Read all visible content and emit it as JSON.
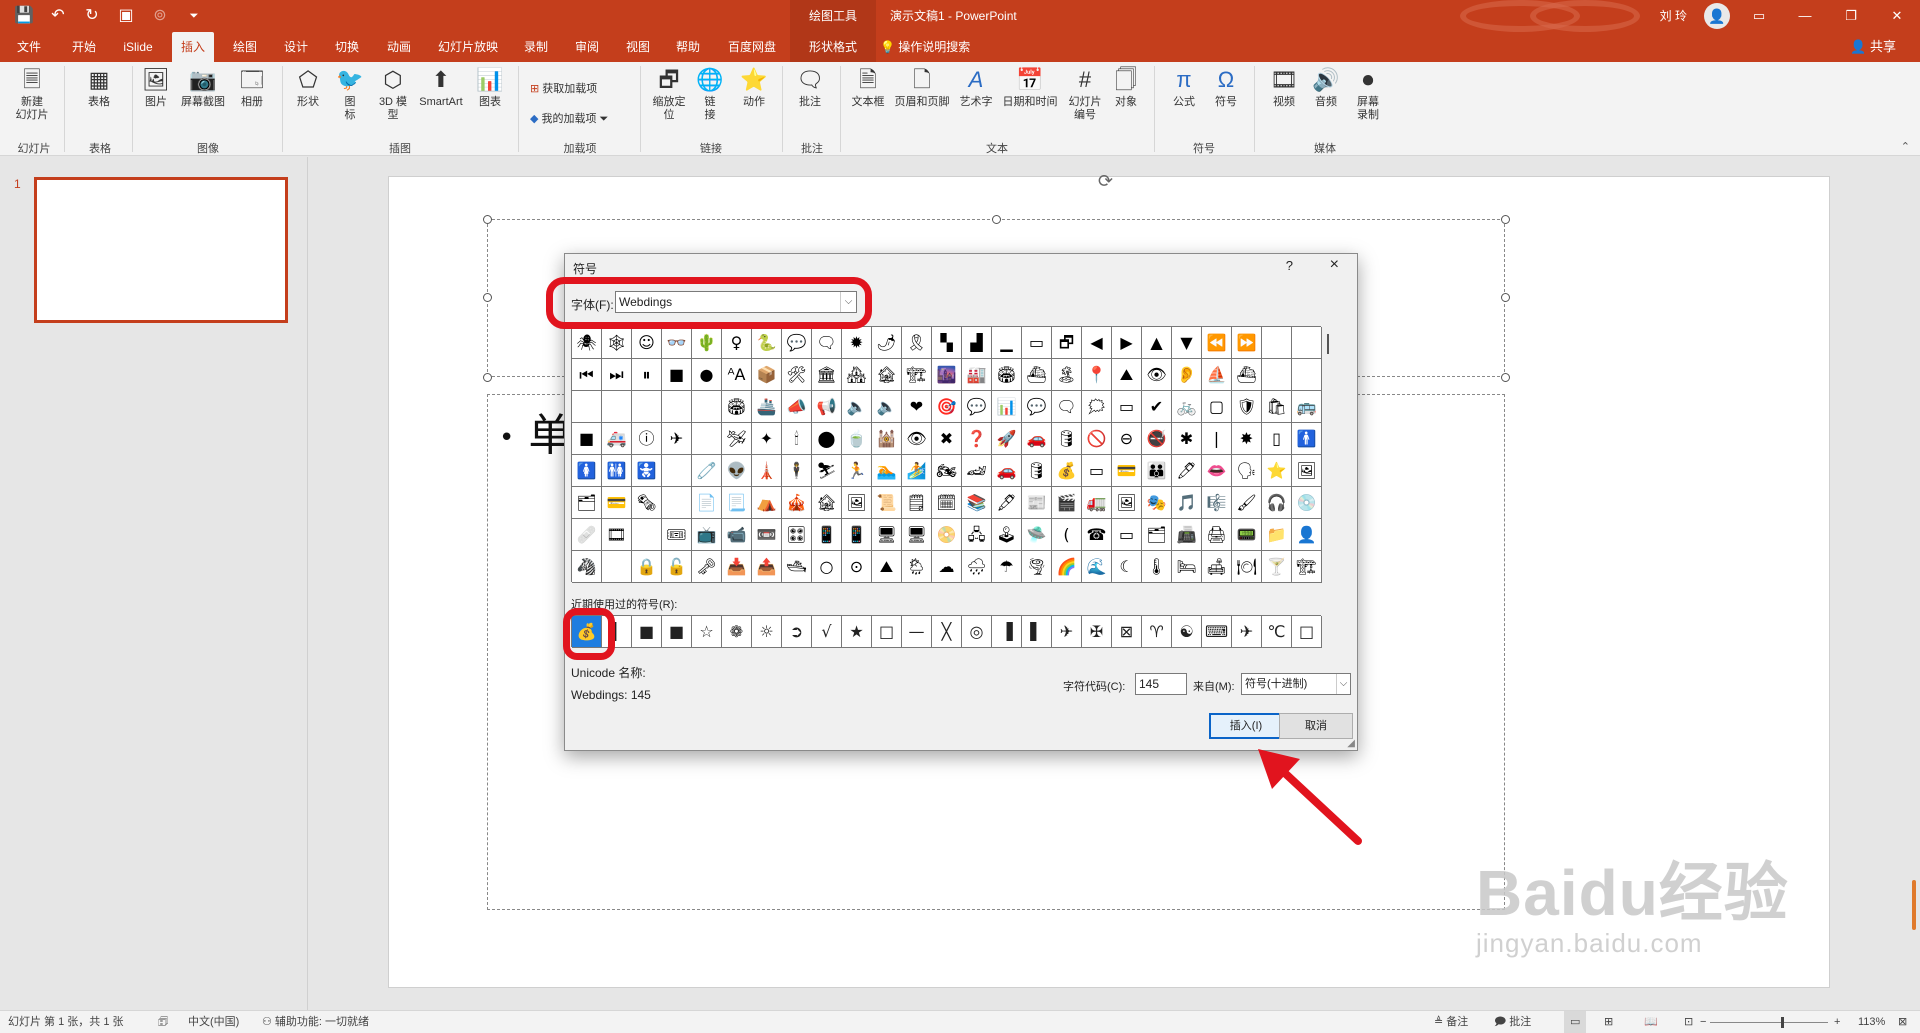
{
  "titlebar": {
    "context_tool": "绘图工具",
    "document_title": "演示文稿1  -  PowerPoint",
    "user_name": "刘 玲",
    "quick_access": [
      "save",
      "undo",
      "redo",
      "start-from-beginning",
      "customize"
    ]
  },
  "tabs": [
    "文件",
    "开始",
    "iSlide",
    "插入",
    "绘图",
    "设计",
    "切换",
    "动画",
    "幻灯片放映",
    "录制",
    "审阅",
    "视图",
    "帮助",
    "百度网盘",
    "形状格式",
    "操作说明搜索"
  ],
  "active_tab": "插入",
  "share_label": "共享",
  "ribbon": {
    "buttons": {
      "new_slide": "新建\n幻灯片",
      "table": "表格",
      "picture": "图片",
      "screenshot": "屏幕截图",
      "album": "相册",
      "shapes": "形状",
      "icons": "图\n标",
      "model3d": "3D 模\n型",
      "smartart": "SmartArt",
      "chart": "图表",
      "get_addins": "获取加载项",
      "my_addins": "我的加载项",
      "zoom": "缩放定\n位",
      "link": "链\n接",
      "action": "动作",
      "comment": "批注",
      "textbox": "文本框",
      "header_footer": "页眉和页脚",
      "wordart": "艺术字",
      "datetime": "日期和时间",
      "slide_number": "幻灯片\n编号",
      "object": "对象",
      "equation": "公式",
      "symbol": "符号",
      "video": "视频",
      "audio": "音频",
      "screen_record": "屏幕\n录制"
    },
    "groups": {
      "slides": "幻灯片",
      "tables": "表格",
      "images": "图像",
      "illustrations": "插图",
      "addins": "加载项",
      "links": "链接",
      "comments": "批注",
      "text": "文本",
      "symbols": "符号",
      "media": "媒体"
    }
  },
  "thumbnail": {
    "slide_number": "1"
  },
  "slide": {
    "bullet_text": "单"
  },
  "dialog": {
    "title": "符号",
    "help": "?",
    "close": "×",
    "font_label": "字体(F):",
    "font_value": "Webdings",
    "grid_symbols": [
      "🕷",
      "🕸",
      "☺",
      "👓",
      "🌵",
      "♀",
      "🐍",
      "💬",
      "🗨",
      "✹",
      "🌶",
      "🎗",
      "▚",
      "▟",
      "▁",
      "▭",
      "🗗",
      "◀",
      "▶",
      "▲",
      "▼",
      "⏪",
      "⏩",
      "",
      "",
      "⏮",
      "⏭",
      "⏸",
      "■",
      "●",
      "ᴬA",
      "📦",
      "🛠",
      "🏛",
      "🏘",
      "🏚",
      "🏗",
      "🌆",
      "🏭",
      "🏟",
      "⛴",
      "🏝",
      "📍",
      "⛰",
      "👁",
      "👂",
      "⛵",
      "⛴",
      "",
      "",
      "",
      "",
      "",
      "",
      "",
      "🏟",
      "🚢",
      "📣",
      "📢",
      "🔈",
      "🔈",
      "❤",
      "🎯",
      "💬",
      "📊",
      "💬",
      "🗨",
      "🗯",
      "▭",
      "✔",
      "🚲",
      "▢",
      "🛡",
      "🛍",
      "🚌",
      "■",
      "🚑",
      "ⓘ",
      "✈",
      "",
      "🛩",
      "✦",
      "🕯",
      "⬤",
      "🍵",
      "🕍",
      "👁",
      "✖",
      "❓",
      "🚀",
      "🚗",
      "🛢",
      "🚫",
      "⊖",
      "🚭",
      "✱",
      "❘",
      "✸",
      "▯",
      "🚹",
      "🚺",
      "🚻",
      "🚼",
      "",
      "🧷",
      "👽",
      "🗼",
      "🕴",
      "⛷",
      "🏃",
      "🏊",
      "🏄",
      "🏍",
      "🏎",
      "🚗",
      "🛢",
      "💰",
      "▭",
      "💳",
      "👪",
      "🖊",
      "👄",
      "🗣",
      "⭐",
      "🖼",
      "🗂",
      "💳",
      "🗞",
      "",
      "📄",
      "📃",
      "⛺",
      "🎪",
      "🏚",
      "🖼",
      "📜",
      "🗒",
      "🗓",
      "📚",
      "🖋",
      "📰",
      "🎬",
      "🚛",
      "🖼",
      "🎭",
      "🎵",
      "🎼",
      "🖌",
      "🎧",
      "💿",
      "🩹",
      "🎞",
      "",
      "🎟",
      "📺",
      "📹",
      "📼",
      "🎛",
      "📱",
      "📱",
      "🖥",
      "🖥",
      "📀",
      "🖧",
      "🕹",
      "🛸",
      "(",
      "☎",
      "▭",
      "🗂",
      "📠",
      "🖨",
      "📟",
      "📁",
      "👤",
      "🦓",
      "",
      "🔒",
      "🔓",
      "🗝",
      "📥",
      "📤",
      "🛥",
      "○",
      "⊙",
      "⛰",
      "🌦",
      "☁",
      "🌧",
      "☂",
      "🌪",
      "🌈",
      "🌊",
      "☾",
      "🌡",
      "🛏",
      "🛋",
      "🍽",
      "🍸",
      "🏗",
      "🥂",
      "🌅"
    ],
    "recent_label": "近期使用过的符号(R):",
    "recent_symbols": [
      "💰",
      "▌",
      "■",
      "■",
      "☆",
      "❁",
      "☼",
      "➲",
      "√",
      "★",
      "□",
      "—",
      "╳",
      "◎",
      "▐",
      "▌",
      "✈",
      "✠",
      "⊠",
      "♈",
      "☯",
      "⌨",
      "✈",
      "℃",
      "□"
    ],
    "unicode_name_label": "Unicode 名称:",
    "unicode_name_value": "Webdings: 145",
    "char_code_label": "字符代码(C):",
    "char_code_value": "145",
    "from_label": "来自(M):",
    "from_value": "符号(十进制)",
    "insert_label": "插入(I)",
    "cancel_label": "取消"
  },
  "statusbar": {
    "slide_info": "幻灯片 第 1 张，共 1 张",
    "language": "中文(中国)",
    "accessibility": "辅助功能: 一切就绪",
    "notes": "备注",
    "comments": "批注",
    "zoom": "113%"
  },
  "watermark": {
    "brand": "Baidu经验",
    "url": "jingyan.baidu.com"
  },
  "colors": {
    "accent": "#c43e1c",
    "annotation": "#e1141e",
    "selection": "#1e7de0"
  }
}
